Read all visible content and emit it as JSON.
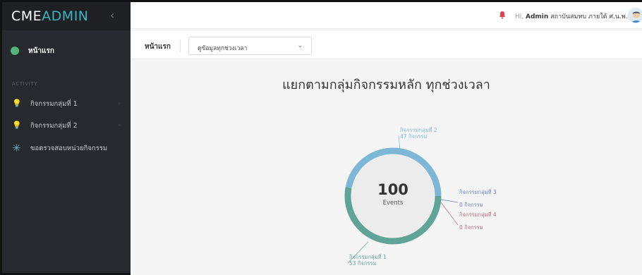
{
  "brand": {
    "part1": "CME",
    "part2": "ADMIN",
    "toggle_icon": "chevron-left-icon"
  },
  "sidebar": {
    "home": {
      "label": "หน้าแรก",
      "icon": "dashboard-icon"
    },
    "section": "ACTIVITY",
    "items": [
      {
        "label": "กิจกรรมกลุ่มที่ 1",
        "icon": "lightbulb-icon",
        "chevron": "›"
      },
      {
        "label": "กิจกรรมกลุ่มที่ 2",
        "icon": "lightbulb-icon",
        "chevron": "›"
      },
      {
        "label": "ขอตรวจสอบหน่วยกิจกรรม",
        "icon": "asterisk-icon"
      }
    ]
  },
  "header": {
    "greeting_prefix": "Hi,",
    "user": "Admin",
    "org": "สถาบันสมทบ ภายใต้ ศ.น.พ."
  },
  "subheader": {
    "title": "หน้าแรก",
    "filter_value": "ดูข้อมูลทุกช่วงเวลา"
  },
  "colors": {
    "group1": "#5fa497",
    "group2": "#7db7d6",
    "group3": "#6a7fb8",
    "group4": "#b4697a",
    "bell": "#e2404f"
  },
  "chart_data": {
    "type": "donut",
    "title": "แยกตามกลุ่มกิจกรรมหลัก ทุกช่วงเวลา",
    "center_value": "100",
    "center_label": "Events",
    "slices": [
      {
        "name": "กิจกรรมกลุ่มที่ 1",
        "value": 53,
        "label": "53 กิจกรรม"
      },
      {
        "name": "กิจกรรมกลุ่มที่ 2",
        "value": 47,
        "label": "47 กิจกรรม"
      },
      {
        "name": "กิจกรรมกลุ่มที่ 3",
        "value": 0,
        "label": "0 กิจกรรม"
      },
      {
        "name": "กิจกรรมกลุ่มที่ 4",
        "value": 0,
        "label": "0 กิจกรรม"
      }
    ]
  }
}
